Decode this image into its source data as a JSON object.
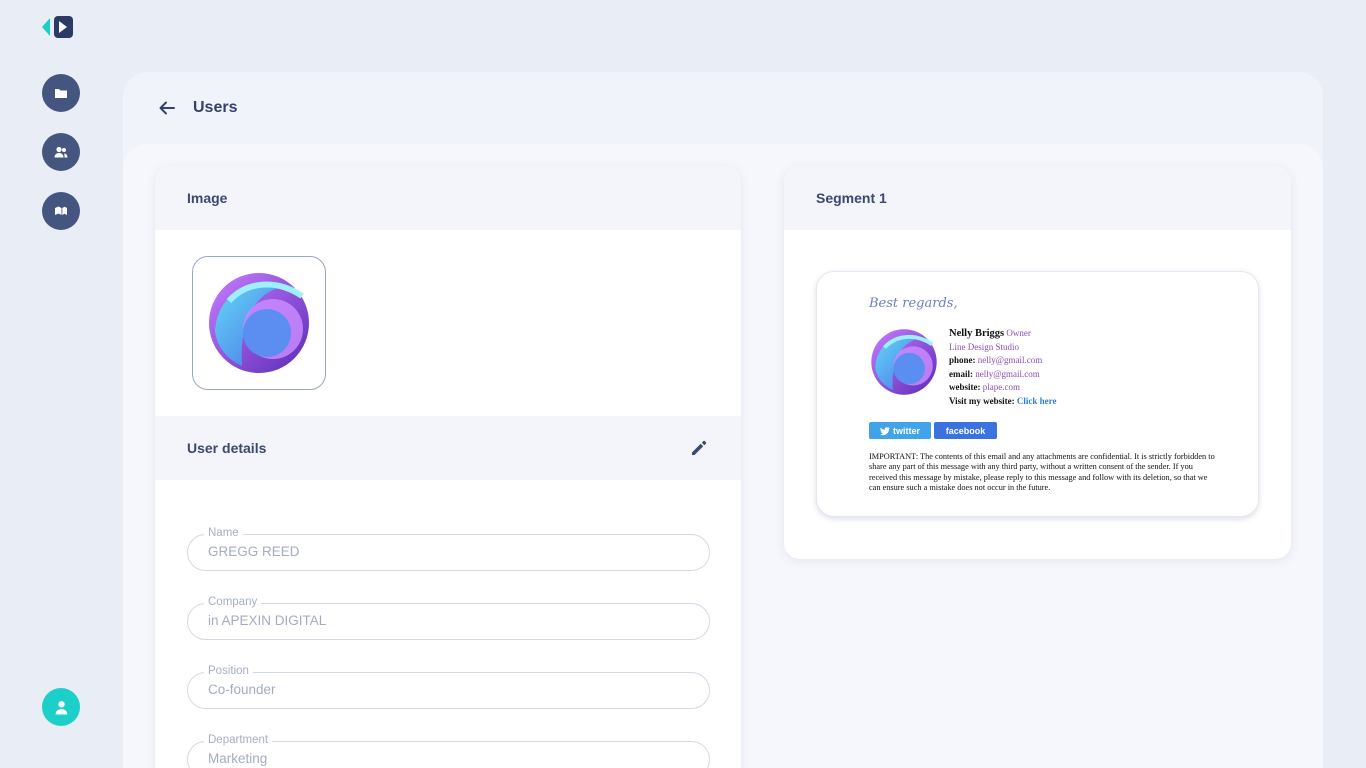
{
  "page": {
    "title": "Users"
  },
  "image_card": {
    "heading": "Image"
  },
  "user_details": {
    "heading": "User details",
    "fields": [
      {
        "label": "Name",
        "value": "GREGG REED"
      },
      {
        "label": "Company",
        "value": "in APEXIN DIGITAL"
      },
      {
        "label": "Position",
        "value": "Co-founder"
      },
      {
        "label": "Department",
        "value": "Marketing"
      }
    ]
  },
  "segment_card": {
    "heading": "Segment 1"
  },
  "signature": {
    "greeting": "Best regards,",
    "name": "Nelly Briggs",
    "role": "Owner",
    "company": "Line Design Studio",
    "phone_label": "phone:",
    "phone": "nelly@gmail.com",
    "email_label": "email:",
    "email": "nelly@gmail.com",
    "website_label": "website:",
    "website": "plape.com",
    "visit_label": "Visit my website:",
    "visit_link": "Click here",
    "twitter_label": "twitter",
    "facebook_label": "facebook",
    "disclaimer": "IMPORTANT: The contents of this email and any attachments are confidential. It is strictly forbidden to share any part of this message with any third party, without a written consent of the sender. If you received this message by mistake, please reply to this message and follow with its deletion, so that we can ensure such a mistake does not occur in the future."
  },
  "colors": {
    "background": "#e8edf6",
    "nav_button": "#44567f",
    "profile_button": "#1ccfc9",
    "text_primary": "#34416b",
    "signature_accent": "#8a4fb7",
    "twitter": "#41a3ea",
    "facebook": "#3a72e0"
  },
  "icons": {
    "logo": "app-logo",
    "nav": [
      "folder-icon",
      "users-icon",
      "segments-icon"
    ],
    "profile": "user-icon",
    "back": "arrow-left-icon",
    "edit": "pencil-icon"
  }
}
